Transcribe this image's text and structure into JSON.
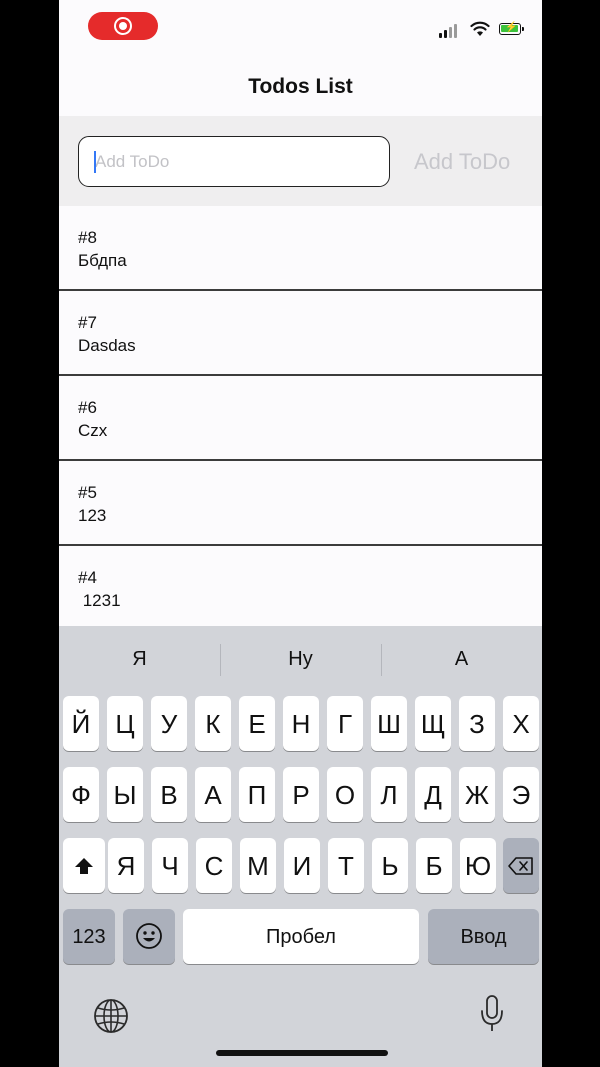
{
  "nav": {
    "title": "Todos List"
  },
  "input": {
    "placeholder": "Add ToDo",
    "button_label": "Add ToDo"
  },
  "todos": [
    {
      "number": "#8",
      "text": "Ббдпа"
    },
    {
      "number": "#7",
      "text": "Dasdas"
    },
    {
      "number": "#6",
      "text": "Czx"
    },
    {
      "number": "#5",
      "text": "123"
    },
    {
      "number": "#4",
      "text": " 1231"
    }
  ],
  "keyboard": {
    "suggestions": [
      "Я",
      "Ну",
      "А"
    ],
    "row1": [
      "Й",
      "Ц",
      "У",
      "К",
      "Е",
      "Н",
      "Г",
      "Ш",
      "Щ",
      "З",
      "Х"
    ],
    "row2": [
      "Ф",
      "Ы",
      "В",
      "А",
      "П",
      "Р",
      "О",
      "Л",
      "Д",
      "Ж",
      "Э"
    ],
    "row3": [
      "Я",
      "Ч",
      "С",
      "М",
      "И",
      "Т",
      "Ь",
      "Б",
      "Ю"
    ],
    "numbers_label": "123",
    "space_label": "Пробел",
    "return_label": "Ввод",
    "icons": {
      "shift": "shift-icon",
      "backspace": "backspace-icon",
      "emoji": "emoji-icon",
      "globe": "globe-icon",
      "mic": "microphone-icon"
    }
  },
  "colors": {
    "record_indicator": "#e52b2b",
    "battery_fill": "#3cc33c",
    "caret": "#3478f6",
    "keyboard_bg": "#d2d4d9"
  }
}
